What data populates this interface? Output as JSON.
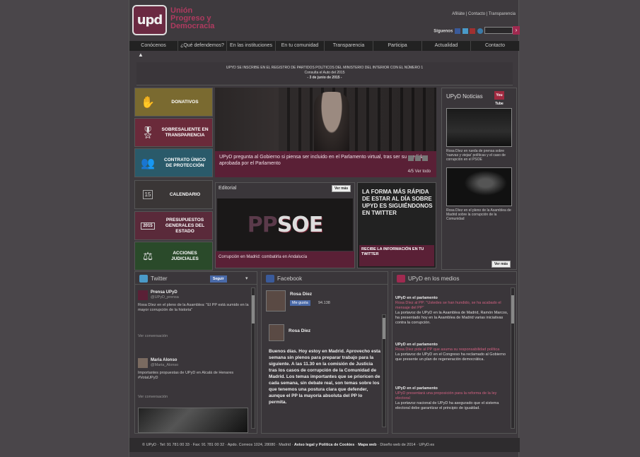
{
  "header": {
    "logo_text": "upd",
    "party_name_line1": "Unión",
    "party_name_line2": "Progreso y",
    "party_name_line3": "Democracia",
    "top_links": "Afiliáte | Contacto | Transparencia",
    "follow_label": "Síguenos",
    "search_placeholder": "",
    "search_button": "›"
  },
  "nav": {
    "items": [
      "Conócenos",
      "¿Qué defendemos?",
      "En las instituciones",
      "En tu comunidad",
      "Transparencia",
      "Participa",
      "Actualidad",
      "Contacto"
    ]
  },
  "notice": {
    "line1": "UPYD SE INSCRIBE EN EL REGISTRO DE PARTIDOS POLÍTICOS DEL MINISTERIO DEL INTERIOR CON EL NÚMERO 1",
    "line2": "Consulta el Auto del 2015",
    "line3": "- 3 de junio de 2015 -"
  },
  "sidebar": {
    "items": [
      {
        "label": "DONATIVOS",
        "color": "#7a6a30"
      },
      {
        "label": "SOBRESALIENTE EN TRANSPARENCIA",
        "color": "#6a2a3a"
      },
      {
        "label": "CONTRATO ÚNICO DE PROTECCIÓN",
        "color": "#2a5a6a"
      },
      {
        "label": "CALENDARIO",
        "color": "#3a3636"
      },
      {
        "label": "PRESUPUESTOS GENERALES DEL ESTADO",
        "color": "#5a2a3a"
      },
      {
        "label": "ACCIONES JUDICIALES",
        "color": "#2a4a2a"
      }
    ],
    "calendar_day": "15",
    "budget_year": "2015"
  },
  "slider": {
    "caption": "UPyD pregunta al Gobierno si piensa ser incluido en el Parlamento virtual, tras ser su medida aprobada por el Parlamento",
    "pager": "4/5  Ver todo"
  },
  "right_column": {
    "title": "UPyD Noticias",
    "youtube_label": "You Tube",
    "video1_caption": "Rosa Díez en rueda de prensa sobre 'nuevas y viejas' políticas y el caso de corrupción en el PSOE",
    "video2_caption": "Rosa Díez en el pleno de la Asamblea de Madrid sobre la corrupción de la Comunidad",
    "see_more": "Ver más"
  },
  "pp_panel": {
    "title": "Editorial",
    "image_text_pp": "PP",
    "image_text_soe": "SOE",
    "caption": "Corrupción en Madrid: combatirla en Andalucía",
    "see_more": "Ver más"
  },
  "promo": {
    "headline": "LA FORMA MÁS RÁPIDA DE ESTAR AL DÍA SOBRE UPYD ES SIGUIÉNDONOS EN TWITTER",
    "footer": "RECIBE LA INFORMACIÓN EN TU TWITTER"
  },
  "twitter": {
    "title": "Twitter",
    "follow_button": "Seguir",
    "tweets": [
      {
        "name": "Prensa UPyD",
        "handle": "@UPyD_prensa",
        "text": "Rosa Díez en el pleno de la Asamblea: \"El PP está sumido en la mayor corrupción de la historia\"",
        "meta": "Ver conversación"
      },
      {
        "name": "Maria Alonso",
        "handle": "@Maria_Alonso",
        "text": "Importantes propuestas de UPyD en Alcalá de Henares #VotaUPyD",
        "meta": "Ver conversación"
      }
    ]
  },
  "facebook": {
    "title": "Facebook",
    "page_name": "Rosa Díez",
    "like_label": "Me gusta",
    "like_count": "94.138",
    "post_author": "Rosa Díez",
    "post_text": "Buenos días. Hoy estoy en Madrid. Aprovecho esta semana sin plenos para preparar trabajo para la siguiente. A las 11.30 en la comisión de Justicia tras los casos de corrupción de la Comunidad de Madrid. Los temas importantes que se prioricen de cada semana, sin debate real, son temas sobre los que tenemos una postura clara que defender, aunque el PP la mayoría absoluta del PP lo permita."
  },
  "news": {
    "title": "UPyD en los medios",
    "items": [
      {
        "source": "UPyD en el parlamento",
        "link": "Rosa Díez al PP: \"Ustedes se han hundido, se ha acabado el mensaje del PP\"",
        "text": "La portavoz de UPyD en la Asamblea de Madrid, Ramón Marcos, ha presentado hoy en la Asamblea de Madrid varias iniciativas contra la corrupción."
      },
      {
        "source": "UPyD en el parlamento",
        "link": "Rosa Díez pide al PP que asuma su responsabilidad política",
        "text": "La portavoz de UPyD en el Congreso ha reclamado al Gobierno que presente un plan de regeneración democrática."
      },
      {
        "source": "UPyD en el parlamento",
        "link": "UPyD presentará una proposición para la reforma de la ley electoral",
        "text": "La portavoz nacional de UPyD ha asegurado que el sistema electoral debe garantizar el principio de igualdad."
      }
    ]
  },
  "footer": {
    "text": "© UPyD · Tel: 91 781 00 33 · Fax: 91 781 00 32 · Apdo. Correos 1024, 28080 · Madrid",
    "legal": "Aviso legal y Política de Cookies",
    "map": "Mapa web",
    "credit": "Diseño web de 2014 · UPyD.es"
  },
  "colors": {
    "accent": "#a02a50",
    "caption_bg": "#5a2036",
    "page_bg": "#3e3a3e"
  }
}
